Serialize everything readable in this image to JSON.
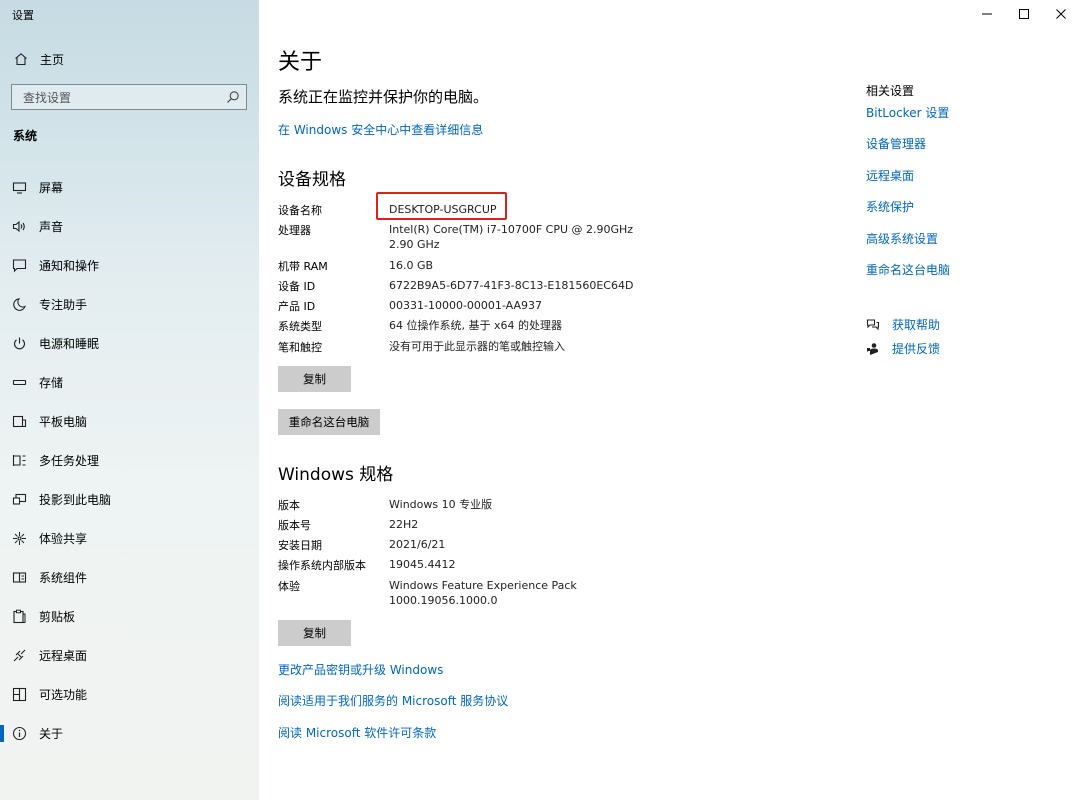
{
  "window": {
    "title": "设置"
  },
  "sidebar": {
    "home_label": "主页",
    "search_placeholder": "查找设置",
    "section_label": "系统",
    "items": [
      {
        "label": "屏幕",
        "icon": "monitor-icon"
      },
      {
        "label": "声音",
        "icon": "speaker-icon"
      },
      {
        "label": "通知和操作",
        "icon": "notification-icon"
      },
      {
        "label": "专注助手",
        "icon": "moon-icon"
      },
      {
        "label": "电源和睡眠",
        "icon": "power-icon"
      },
      {
        "label": "存储",
        "icon": "storage-icon"
      },
      {
        "label": "平板电脑",
        "icon": "tablet-icon"
      },
      {
        "label": "多任务处理",
        "icon": "multitask-icon"
      },
      {
        "label": "投影到此电脑",
        "icon": "project-icon"
      },
      {
        "label": "体验共享",
        "icon": "share-icon"
      },
      {
        "label": "系统组件",
        "icon": "components-icon"
      },
      {
        "label": "剪贴板",
        "icon": "clipboard-icon"
      },
      {
        "label": "远程桌面",
        "icon": "remote-icon"
      },
      {
        "label": "可选功能",
        "icon": "features-icon"
      },
      {
        "label": "关于",
        "icon": "info-icon",
        "active": true
      }
    ]
  },
  "main": {
    "title": "关于",
    "protect_text": "系统正在监控并保护你的电脑。",
    "security_link": "在 Windows 安全中心中查看详细信息",
    "device_specs": {
      "heading": "设备规格",
      "rows": [
        {
          "key": "设备名称",
          "value": "DESKTOP-USGRCUP"
        },
        {
          "key": "处理器",
          "value": "Intel(R) Core(TM) i7-10700F CPU @ 2.90GHz   2.90 GHz"
        },
        {
          "key": "机带 RAM",
          "value": "16.0 GB"
        },
        {
          "key": "设备 ID",
          "value": "6722B9A5-6D77-41F3-8C13-E181560EC64D"
        },
        {
          "key": "产品 ID",
          "value": "00331-10000-00001-AA937"
        },
        {
          "key": "系统类型",
          "value": "64 位操作系统, 基于 x64 的处理器"
        },
        {
          "key": "笔和触控",
          "value": "没有可用于此显示器的笔或触控输入"
        }
      ],
      "copy_button": "复制",
      "rename_button": "重命名这台电脑"
    },
    "windows_specs": {
      "heading": "Windows 规格",
      "rows": [
        {
          "key": "版本",
          "value": "Windows 10 专业版"
        },
        {
          "key": "版本号",
          "value": "22H2"
        },
        {
          "key": "安装日期",
          "value": "2021/6/21"
        },
        {
          "key": "操作系统内部版本",
          "value": "19045.4412"
        },
        {
          "key": "体验",
          "value": "Windows Feature Experience Pack 1000.19056.1000.0"
        }
      ],
      "copy_button": "复制"
    },
    "links": [
      "更改产品密钥或升级 Windows",
      "阅读适用于我们服务的 Microsoft 服务协议",
      "阅读 Microsoft 软件许可条款"
    ]
  },
  "related": {
    "heading": "相关设置",
    "links": [
      "BitLocker 设置",
      "设备管理器",
      "远程桌面",
      "系统保护",
      "高级系统设置",
      "重命名这台电脑"
    ],
    "help_label": "获取帮助",
    "feedback_label": "提供反馈"
  },
  "colors": {
    "accent": "#0067c0",
    "highlight_box": "#e02020",
    "button": "#cccccc"
  }
}
